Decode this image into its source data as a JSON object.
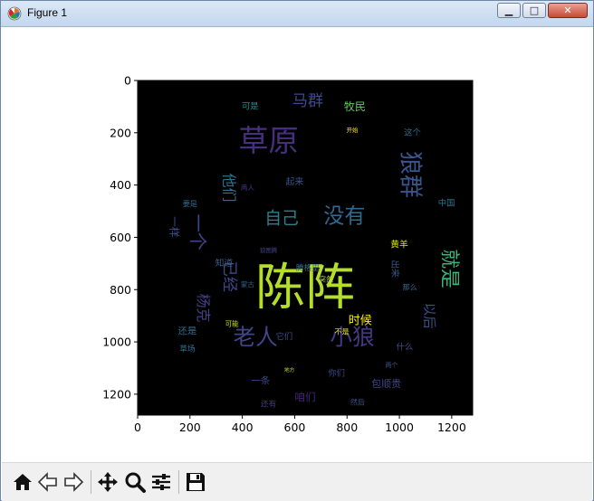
{
  "window": {
    "title": "Figure 1",
    "minimize_glyph": "▁",
    "maximize_glyph": "□",
    "close_glyph": "✕"
  },
  "toolbar": {
    "buttons": [
      "home-icon",
      "back-arrow-icon",
      "forward-arrow-icon",
      "pan-icon",
      "zoom-icon",
      "configure-subplots-icon",
      "save-icon"
    ]
  },
  "chart_data": {
    "type": "wordcloud-image",
    "x_ticks": [
      "0",
      "200",
      "400",
      "600",
      "800",
      "1000",
      "1200"
    ],
    "y_ticks": [
      "0",
      "200",
      "400",
      "600",
      "800",
      "1000",
      "1200"
    ],
    "xlim": [
      0,
      1280
    ],
    "ylim": [
      1280,
      0
    ],
    "background": "#000000",
    "words": [
      {
        "text": "陈阵",
        "x": 640,
        "y": 790,
        "size": 190,
        "color": "#b5de2b"
      },
      {
        "text": "草原",
        "x": 500,
        "y": 230,
        "size": 115,
        "color": "#472f7d"
      },
      {
        "text": "狼群",
        "x": 1040,
        "y": 360,
        "size": 90,
        "color": "#3a548c",
        "vertical": true
      },
      {
        "text": "没有",
        "x": 790,
        "y": 520,
        "size": 80,
        "color": "#31688e"
      },
      {
        "text": "自己",
        "x": 550,
        "y": 530,
        "size": 65,
        "color": "#26828e"
      },
      {
        "text": "老人",
        "x": 450,
        "y": 980,
        "size": 85,
        "color": "#414487"
      },
      {
        "text": "小狼",
        "x": 820,
        "y": 980,
        "size": 85,
        "color": "#443983"
      },
      {
        "text": "就是",
        "x": 1190,
        "y": 720,
        "size": 75,
        "color": "#35b779",
        "vertical": true
      },
      {
        "text": "马群",
        "x": 650,
        "y": 80,
        "size": 60,
        "color": "#3e4a89"
      },
      {
        "text": "一个",
        "x": 230,
        "y": 580,
        "size": 70,
        "color": "#404688",
        "vertical": true
      },
      {
        "text": "他们",
        "x": 350,
        "y": 410,
        "size": 55,
        "color": "#2c728e",
        "vertical": true
      },
      {
        "text": "已经",
        "x": 350,
        "y": 750,
        "size": 60,
        "color": "#3f4889",
        "vertical": true
      },
      {
        "text": "杨克",
        "x": 250,
        "y": 870,
        "size": 55,
        "color": "#433e85",
        "vertical": true
      },
      {
        "text": "时候",
        "x": 850,
        "y": 920,
        "size": 45,
        "color": "#fde725"
      },
      {
        "text": "以后",
        "x": 1110,
        "y": 900,
        "size": 50,
        "color": "#3b528b",
        "vertical": true
      },
      {
        "text": "牧民",
        "x": 830,
        "y": 100,
        "size": 42,
        "color": "#5ec962"
      },
      {
        "text": "咱们",
        "x": 640,
        "y": 1210,
        "size": 40,
        "color": "#482475"
      },
      {
        "text": "包顺贵",
        "x": 950,
        "y": 1160,
        "size": 38,
        "color": "#414487"
      },
      {
        "text": "中国",
        "x": 1180,
        "y": 470,
        "size": 32,
        "color": "#2a788e"
      },
      {
        "text": "一样",
        "x": 140,
        "y": 560,
        "size": 40,
        "color": "#3b518b",
        "vertical": true
      },
      {
        "text": "知道",
        "x": 330,
        "y": 700,
        "size": 34,
        "color": "#365d8d"
      },
      {
        "text": "还是",
        "x": 190,
        "y": 960,
        "size": 36,
        "color": "#2f6c8e"
      },
      {
        "text": "你们",
        "x": 760,
        "y": 1120,
        "size": 32,
        "color": "#3e4989"
      },
      {
        "text": "可是",
        "x": 430,
        "y": 100,
        "size": 32,
        "color": "#21918c"
      },
      {
        "text": "起来",
        "x": 600,
        "y": 390,
        "size": 34,
        "color": "#3a538b"
      },
      {
        "text": "这个",
        "x": 1050,
        "y": 200,
        "size": 32,
        "color": "#2c718e"
      },
      {
        "text": "黄羊",
        "x": 1000,
        "y": 630,
        "size": 34,
        "color": "#dde318"
      },
      {
        "text": "什么",
        "x": 1020,
        "y": 1020,
        "size": 32,
        "color": "#3d4e8a"
      },
      {
        "text": "出来",
        "x": 980,
        "y": 720,
        "size": 34,
        "color": "#39568c",
        "vertical": true
      },
      {
        "text": "那么",
        "x": 1040,
        "y": 790,
        "size": 28,
        "color": "#31678e"
      },
      {
        "text": "两人",
        "x": 420,
        "y": 410,
        "size": 26,
        "color": "#46307e"
      },
      {
        "text": "它们",
        "x": 560,
        "y": 980,
        "size": 32,
        "color": "#3e4a89"
      },
      {
        "text": "然后",
        "x": 840,
        "y": 1230,
        "size": 28,
        "color": "#3b528b"
      },
      {
        "text": "还有",
        "x": 500,
        "y": 1240,
        "size": 30,
        "color": "#443983"
      },
      {
        "text": "突然",
        "x": 720,
        "y": 760,
        "size": 28,
        "color": "#bddf26"
      },
      {
        "text": "不是",
        "x": 780,
        "y": 960,
        "size": 28,
        "color": "#e5e419"
      },
      {
        "text": "腾格里",
        "x": 650,
        "y": 720,
        "size": 30,
        "color": "#2d718e"
      },
      {
        "text": "一条",
        "x": 470,
        "y": 1150,
        "size": 36,
        "color": "#3e4a89"
      },
      {
        "text": "草场",
        "x": 190,
        "y": 1030,
        "size": 30,
        "color": "#2e6f8e"
      },
      {
        "text": "开始",
        "x": 820,
        "y": 190,
        "size": 22,
        "color": "#fde725"
      },
      {
        "text": "狼图腾",
        "x": 500,
        "y": 650,
        "size": 22,
        "color": "#414487"
      },
      {
        "text": "蒙古",
        "x": 420,
        "y": 780,
        "size": 26,
        "color": "#33638d"
      },
      {
        "text": "可能",
        "x": 360,
        "y": 930,
        "size": 26,
        "color": "#cae11f"
      },
      {
        "text": "地方",
        "x": 580,
        "y": 1110,
        "size": 20,
        "color": "#c2df23"
      },
      {
        "text": "两个",
        "x": 970,
        "y": 1090,
        "size": 24,
        "color": "#39568c"
      },
      {
        "text": "要是",
        "x": 200,
        "y": 470,
        "size": 28,
        "color": "#306a8e"
      }
    ]
  }
}
